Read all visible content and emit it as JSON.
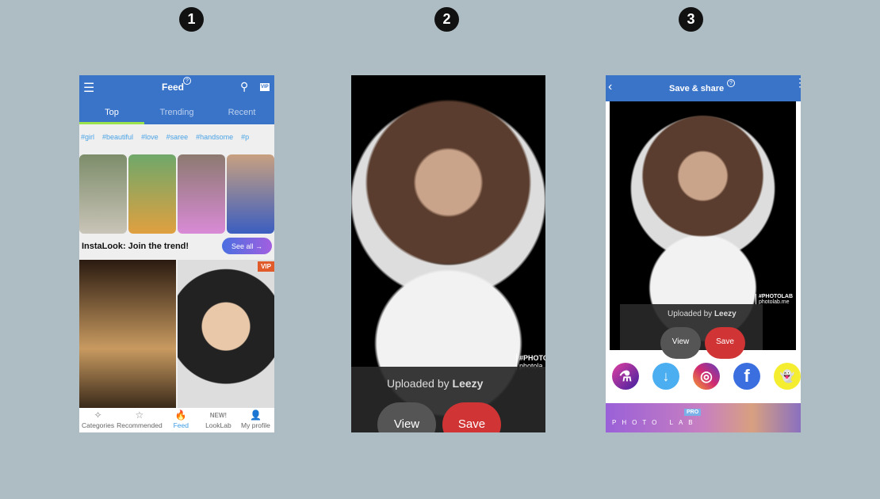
{
  "steps": [
    "1",
    "2",
    "3"
  ],
  "screen1": {
    "title": "Feed",
    "help": "?",
    "vip": "VIP",
    "tabs": [
      "Top",
      "Trending",
      "Recent"
    ],
    "hashtags": [
      "#girl",
      "#beautiful",
      "#love",
      "#saree",
      "#handsome",
      "#p"
    ],
    "section_title": "InstaLook: Join the trend!",
    "see_all": "See all →",
    "card_badge": "VIP",
    "nav": [
      {
        "label": "Categories",
        "icon": "✧"
      },
      {
        "label": "Recommended",
        "icon": "☆"
      },
      {
        "label": "Feed",
        "icon": "🔥"
      },
      {
        "label": "LookLab",
        "icon": "NEW!"
      },
      {
        "label": "My profile",
        "icon": "👤"
      }
    ],
    "accent": "#3a74c9",
    "active_tab_color": "#9be34d"
  },
  "screen2": {
    "uploaded_by": "Uploaded by",
    "user": "Leezy",
    "view": "View",
    "save": "Save",
    "watermark": "#PHOTO",
    "watermark2": "photola"
  },
  "screen3": {
    "title": "Save & share",
    "help": "?",
    "uploaded_by": "Uploaded by",
    "user": "Leezy",
    "view": "View",
    "save": "Save",
    "watermark": "#PHOTOLAB",
    "watermark2": "photolab.me",
    "share": [
      {
        "name": "photolab",
        "icon": "⚗"
      },
      {
        "name": "download",
        "icon": "↓"
      },
      {
        "name": "instagram",
        "icon": "◎"
      },
      {
        "name": "facebook",
        "icon": "f"
      },
      {
        "name": "snapchat",
        "icon": "👻"
      }
    ],
    "banner_text": "PHOTO LAB",
    "banner_badge": "PRO"
  }
}
